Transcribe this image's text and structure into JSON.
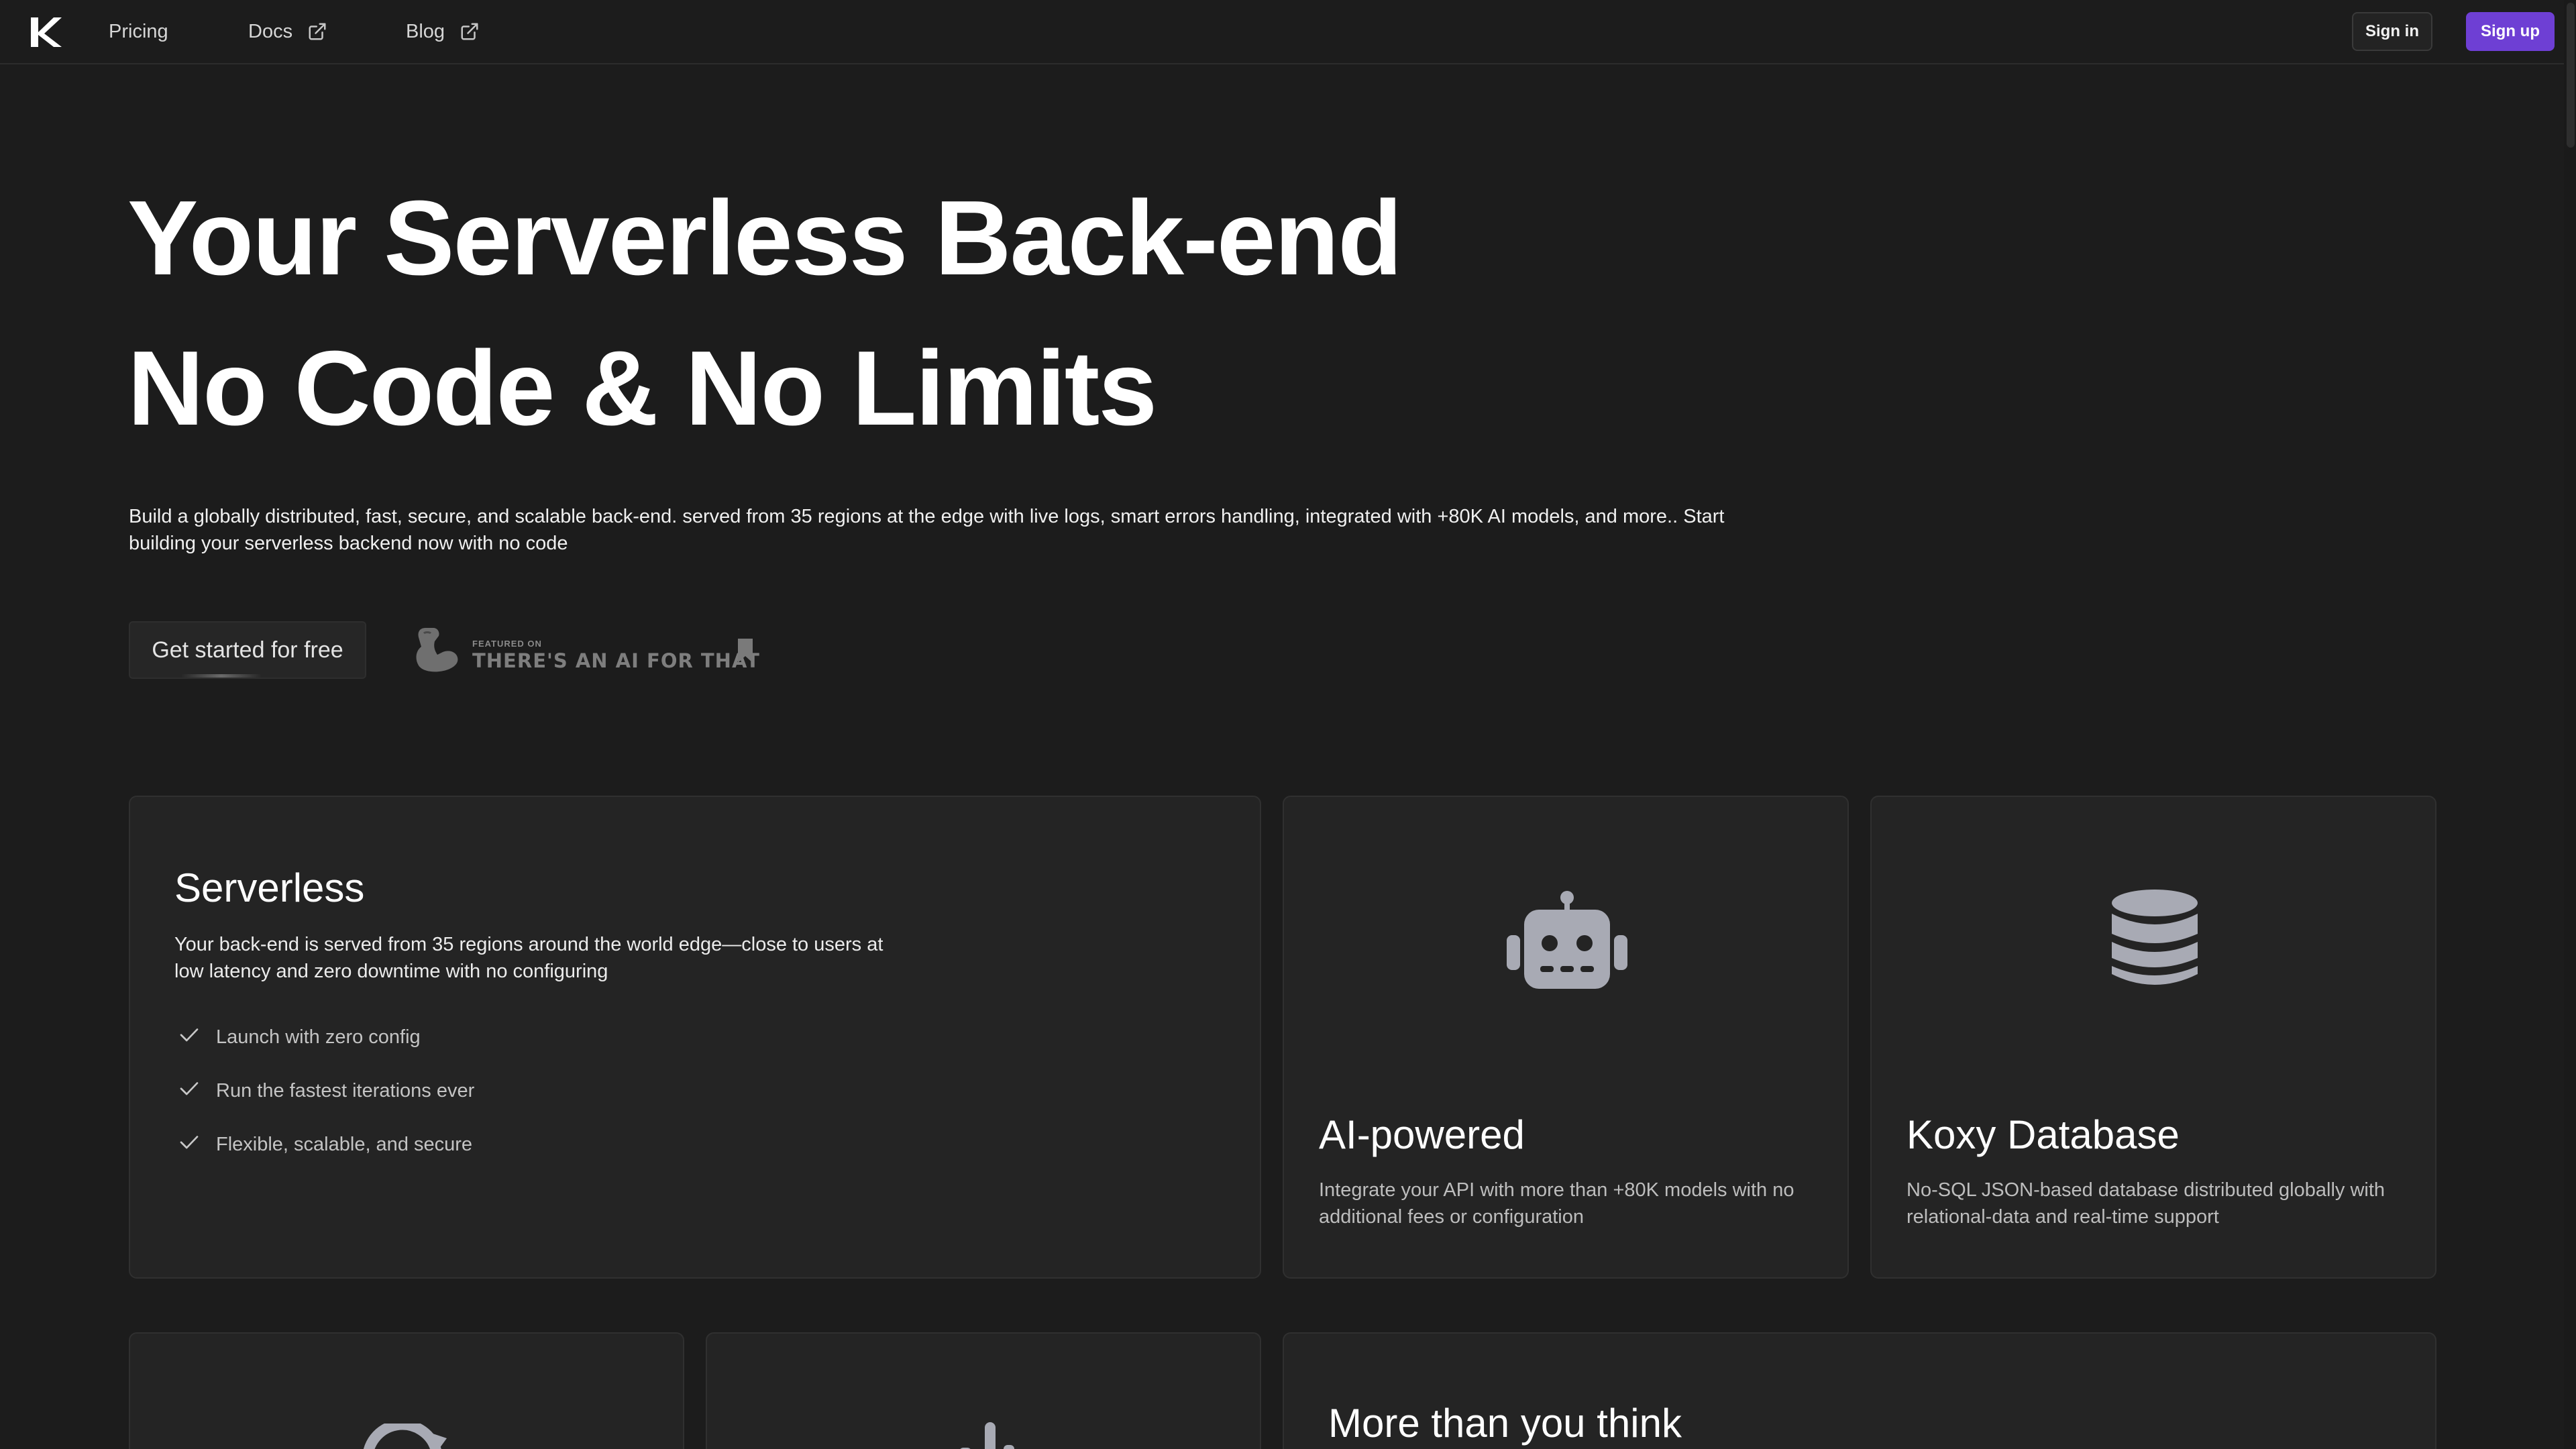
{
  "nav": {
    "logo_alt": "K",
    "links": [
      {
        "label": "Pricing",
        "external": false
      },
      {
        "label": "Docs",
        "external": true
      },
      {
        "label": "Blog",
        "external": true
      }
    ],
    "sign_in": "Sign in",
    "sign_up": "Sign up"
  },
  "hero": {
    "line1": "Your Serverless Back-end",
    "line2": "No Code & No Limits",
    "description": "Build a globally distributed, fast, secure, and scalable back-end. served from 35 regions at the edge with live logs, smart errors handling, integrated with +80K AI models, and more.. Start building your serverless backend now with no code",
    "cta": "Get started for free",
    "featured_small": "FEATURED ON",
    "featured_big": "THERE'S AN AI FOR THAT"
  },
  "cards": {
    "serverless": {
      "title": "Serverless",
      "description": "Your back-end is served from 35 regions around the world edge—close to users at low latency and zero downtime with no configuring",
      "features": [
        "Launch with zero config",
        "Run the fastest iterations ever",
        "Flexible, scalable, and secure"
      ]
    },
    "ai": {
      "title": "AI-powered",
      "description": "Integrate your API with more than +80K models with no additional fees or configuration",
      "icon": "robot-icon"
    },
    "database": {
      "title": "Koxy Database",
      "description": "No-SQL JSON-based database distributed globally with relational-data and real-time support",
      "icon": "database-icon"
    },
    "more": {
      "title": "More than you think"
    }
  },
  "colors": {
    "background": "#1c1c1c",
    "card": "#242424",
    "accent": "#6e3fd4",
    "icon": "#a8aab4"
  }
}
